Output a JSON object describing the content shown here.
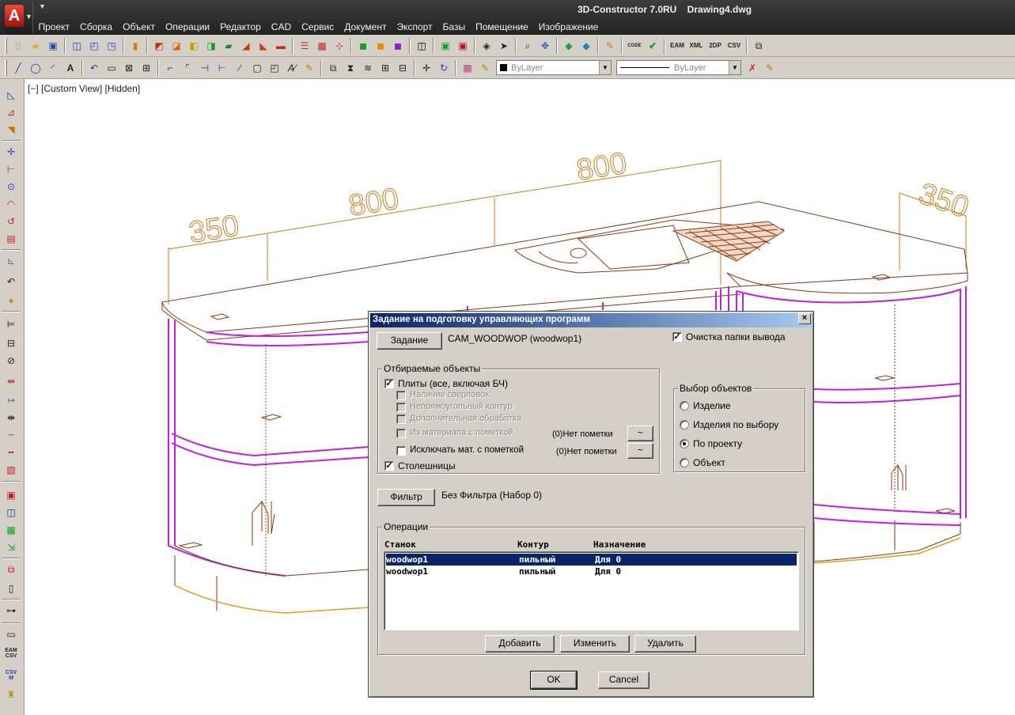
{
  "titlebar": {
    "app_logo": "A",
    "title": "3D-Constructor 7.0RU    Drawing4.dwg"
  },
  "menu": [
    "Проект",
    "Сборка",
    "Объект",
    "Операции",
    "Редактор",
    "CAD",
    "Сервис",
    "Документ",
    "Экспорт",
    "Базы",
    "Помещение",
    "Изображение"
  ],
  "toolbar": {
    "code_label": "CODE",
    "eam_label": "EAM",
    "xml_label": "XML",
    "twodp_label": "2DP",
    "csv_label": "CSV",
    "layer_combo": "ByLayer",
    "linetype_combo": "ByLayer"
  },
  "left_toolbar": {
    "eam_csv_label": "EAM CSV",
    "csv_m_label": "CSV M"
  },
  "viewport": {
    "view_label": "[−] [Custom View] [Hidden]",
    "dimensions": [
      "350",
      "800",
      "800",
      "350"
    ]
  },
  "colors": {
    "dimension": "#d07a1a",
    "wood": "#8a3a12",
    "panel": "#c020e0",
    "selection": "#0a246a"
  },
  "dialog": {
    "title": "Задание на подготовку управляющих программ",
    "task_button": "Задание",
    "task_value": "CAM_WOODWOP (woodwop1)",
    "clear_folder": {
      "label": "Очистка папки вывода",
      "checked": true
    },
    "filter_group": {
      "title": "Отбираемые объекты",
      "plates": {
        "label": "Плиты (все, включая БЧ)",
        "checked": true
      },
      "drilling": {
        "label": "Наличие сверловок",
        "checked": false,
        "enabled": false
      },
      "contour": {
        "label": "Непрямоугольный контур",
        "checked": false,
        "enabled": false
      },
      "extra": {
        "label": "Дополнительная обработка",
        "checked": false,
        "enabled": false
      },
      "material_mark": {
        "label": "Из материала с пометкой",
        "checked": false,
        "enabled": false,
        "status": "(0)Нет пометки",
        "button": "~"
      },
      "exclude_mat": {
        "label": "Исключать мат. с пометкой",
        "checked": false,
        "status": "(0)Нет пометки",
        "button": "~"
      },
      "countertops": {
        "label": "Столешницы",
        "checked": true
      }
    },
    "select_group": {
      "title": "Выбор объектов",
      "options": [
        "Изделие",
        "Изделия по выбору",
        "По проекту",
        "Объект"
      ],
      "selected": 2
    },
    "filter_button": "Фильтр",
    "filter_value": "Без Фильтра (Набор 0)",
    "operations": {
      "title": "Операции",
      "columns": [
        "Станок",
        "Контур",
        "Назначение"
      ],
      "rows": [
        {
          "machine": "woodwop1",
          "contour": "пильный",
          "purpose": "Для 0",
          "selected": true
        },
        {
          "machine": "woodwop1",
          "contour": "пильный",
          "purpose": "Для 0",
          "selected": false
        }
      ],
      "add": "Добавить",
      "edit": "Изменить",
      "delete": "Удалить"
    },
    "ok": "OK",
    "cancel": "Cancel",
    "close_symbol": "×"
  }
}
